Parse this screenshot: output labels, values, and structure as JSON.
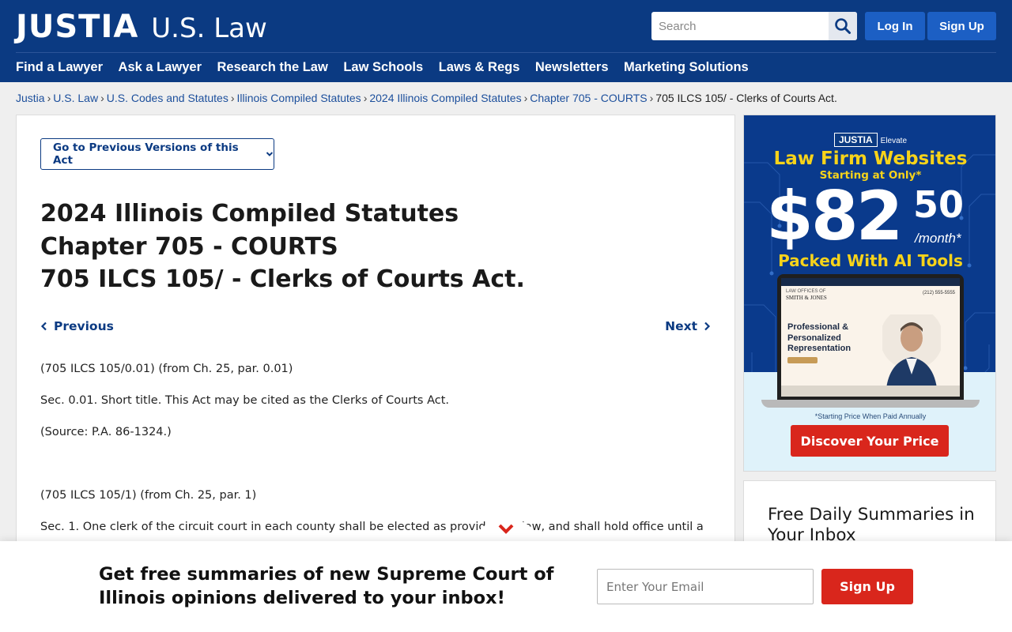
{
  "header": {
    "logo_main": "JUSTIA",
    "logo_sub": "U.S. Law",
    "search_placeholder": "Search",
    "login_label": "Log In",
    "signup_label": "Sign Up",
    "nav": [
      "Find a Lawyer",
      "Ask a Lawyer",
      "Research the Law",
      "Law Schools",
      "Laws & Regs",
      "Newsletters",
      "Marketing Solutions"
    ]
  },
  "breadcrumb": {
    "links": [
      "Justia",
      "U.S. Law",
      "U.S. Codes and Statutes",
      "Illinois Compiled Statutes",
      "2024 Illinois Compiled Statutes",
      "Chapter 705 - COURTS"
    ],
    "separator": "›",
    "current": "705 ILCS 105/ - Clerks of Courts Act."
  },
  "main": {
    "prev_versions_label": "Go to Previous Versions of this Act",
    "title_lines": [
      "2024 Illinois Compiled Statutes",
      "Chapter 705 - COURTS",
      "705 ILCS 105/ - Clerks of Courts Act."
    ],
    "prev_label": "Previous",
    "next_label": "Next",
    "paragraphs": [
      "(705 ILCS 105/0.01) (from Ch. 25, par. 0.01)",
      "Sec. 0.01. Short title. This Act may be cited as the Clerks of Courts Act.",
      "(Source: P.A. 86-1324.)",
      "(705 ILCS 105/1) (from Ch. 25, par. 1)",
      "Sec. 1. One clerk of the circuit court in each county shall be elected as provided by law, and shall hold office until a"
    ]
  },
  "ad": {
    "brand": "JUSTIA",
    "brand_sub": "Elevate",
    "headline": "Law Firm Websites",
    "subheadline": "Starting at Only*",
    "price": "$82",
    "price_cents": "50",
    "per_month": "/month*",
    "tagline": "Packed With AI Tools",
    "screen_firm_small": "LAW OFFICES OF",
    "screen_firm": "SMITH & JONES",
    "screen_phone": "(212) 555-5555",
    "screen_headline": [
      "Professional &",
      "Personalized",
      "Representation"
    ],
    "note": "*Starting Price When Paid Annually",
    "cta": "Discover Your Price"
  },
  "summaries_card": {
    "title_lines": [
      "Free Daily Summaries in",
      "Your Inbox"
    ]
  },
  "banner": {
    "text_lines": [
      "Get free summaries of new Supreme Court of",
      "Illinois opinions delivered to your inbox!"
    ],
    "email_placeholder": "Enter Your Email",
    "signup_label": "Sign Up"
  },
  "colors": {
    "brand_blue": "#0b3a82",
    "button_blue": "#1c5fc4",
    "link_blue": "#1c4f9c",
    "accent_red": "#d9261c",
    "ad_yellow": "#f7d31a"
  },
  "icons": {
    "search": "search-icon",
    "prev": "chevron-left-icon",
    "next": "chevron-right-icon",
    "dropdown": "chevron-down-icon",
    "collapse": "chevron-down-icon"
  }
}
